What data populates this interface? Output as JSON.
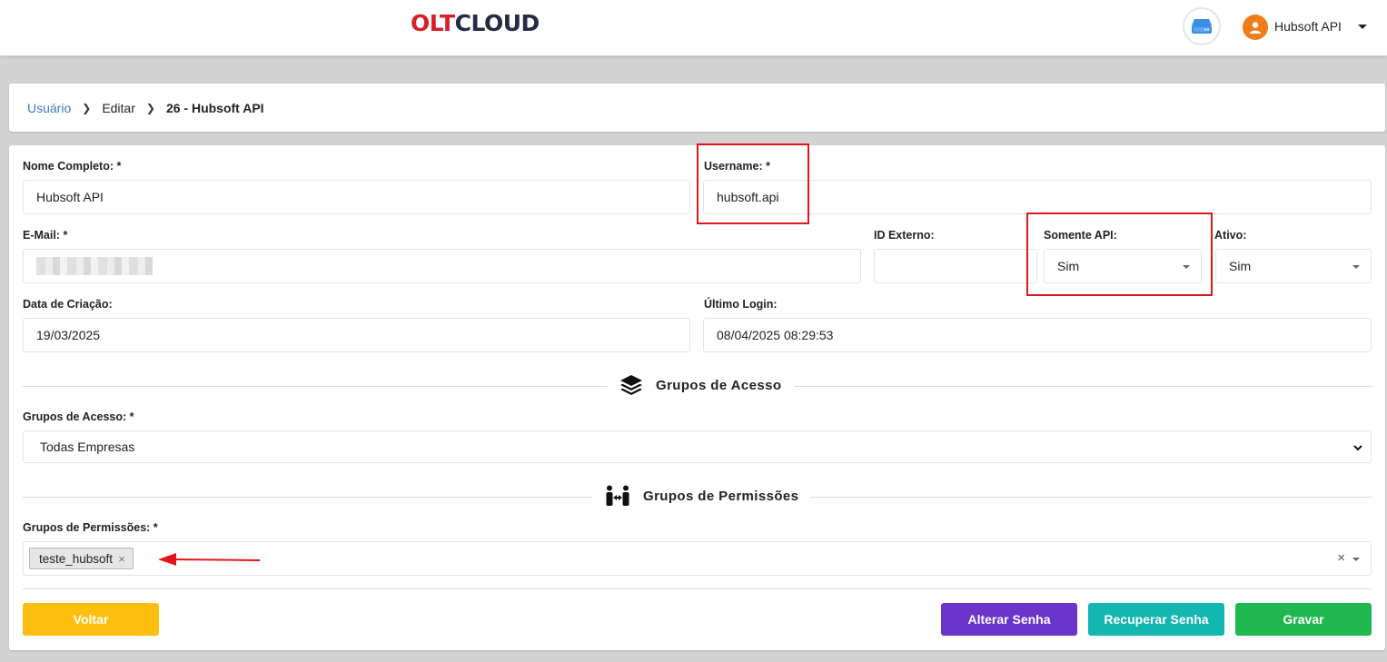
{
  "header": {
    "logo_part1": "OLT",
    "logo_part2": "CLOUD",
    "user_name": "Hubsoft API"
  },
  "breadcrumb": {
    "root": "Usuário",
    "step": "Editar",
    "current": "26 - Hubsoft API"
  },
  "form": {
    "nome_completo": {
      "label": "Nome Completo: *",
      "value": "Hubsoft API"
    },
    "username": {
      "label": "Username: *",
      "value": "hubsoft.api"
    },
    "email": {
      "label": "E-Mail: *",
      "value": ""
    },
    "id_externo": {
      "label": "ID Externo:",
      "value": ""
    },
    "somente_api": {
      "label": "Somente API:",
      "value": "Sim"
    },
    "ativo": {
      "label": "Ativo:",
      "value": "Sim"
    },
    "data_criacao": {
      "label": "Data de Criação:",
      "value": "19/03/2025"
    },
    "ultimo_login": {
      "label": "Último Login:",
      "value": "08/04/2025 08:29:53"
    }
  },
  "grupos_acesso": {
    "section_title": "Grupos de Acesso",
    "label": "Grupos de Acesso: *",
    "value": "Todas Empresas"
  },
  "grupos_permissoes": {
    "section_title": "Grupos de Permissões",
    "label": "Grupos de Permissões: *",
    "tags": [
      "teste_hubsoft"
    ],
    "clear_symbol": "×"
  },
  "buttons": {
    "voltar": "Voltar",
    "alterar_senha": "Alterar Senha",
    "recuperar_senha": "Recuperar Senha",
    "gravar": "Gravar"
  },
  "colors": {
    "logo_red": "#d6202b",
    "logo_dark": "#262b45",
    "link_blue": "#3a78c3",
    "btn_voltar": "#fdbf0f",
    "btn_alterar": "#6a35c8",
    "btn_recuperar": "#14b6b0",
    "btn_gravar": "#1fb84f",
    "annotation_red": "#e2141c"
  },
  "icons": {
    "server": "server-icon",
    "avatar": "user-avatar-icon",
    "layers": "layers-icon",
    "permissions": "people-arrows-icon"
  }
}
